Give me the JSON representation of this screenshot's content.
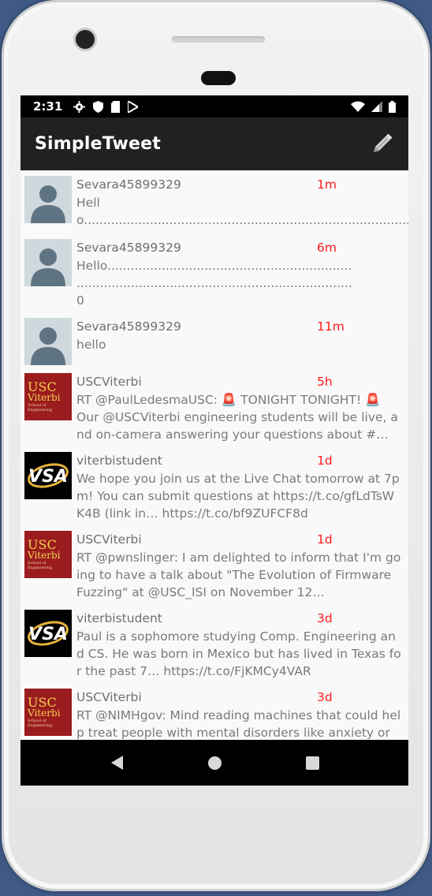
{
  "status_bar": {
    "time": "2:31"
  },
  "app_bar": {
    "title": "SimpleTweet",
    "compose_icon": "pencil-icon"
  },
  "colors": {
    "time_red": "#ff1a1a",
    "appbar": "#212121",
    "usc_red": "#9b1c1f",
    "usc_gold": "#f4d24b"
  },
  "tweets": [
    {
      "user": "Sevara45899329",
      "time": "1m",
      "text": "Hello..................................................................................................................................................",
      "avatar": "default-avatar"
    },
    {
      "user": "Sevara45899329",
      "time": "6m",
      "text": "Hello...............................................................\n.......................................................................\n0",
      "avatar": "default-avatar"
    },
    {
      "user": "Sevara45899329",
      "time": "11m",
      "text": "hello",
      "avatar": "default-avatar"
    },
    {
      "user": "USCViterbi",
      "time": "5h",
      "text": "RT @PaulLedesmaUSC: 🚨 TONIGHT TONIGHT! 🚨\nOur @USCViterbi engineering students will be live, and on-camera answering your questions about #…",
      "avatar": "usc-logo"
    },
    {
      "user": "viterbistudent",
      "time": "1d",
      "text": "We hope you join us at the Live Chat tomorrow at 7pm! You can submit questions at https://t.co/gfLdTsWK4B (link in… https://t.co/bf9ZUFCF8d",
      "avatar": "vsa-logo"
    },
    {
      "user": "USCViterbi",
      "time": "1d",
      "text": "RT @pwnslinger: I am delighted to inform that I'm going to have a talk about \"The Evolution of Firmware Fuzzing\" at @USC_ISI on November 12…",
      "avatar": "usc-logo"
    },
    {
      "user": "viterbistudent",
      "time": "3d",
      "text": "Paul is a sophomore studying Comp. Engineering and CS. He was born in Mexico but has lived in Texas for the past 7… https://t.co/FjKMCy4VAR",
      "avatar": "vsa-logo"
    },
    {
      "user": "USCViterbi",
      "time": "3d",
      "text": "RT @NIMHgov: Mind reading machines that could help treat people with mental disorders like anxiety or",
      "avatar": "usc-logo"
    }
  ],
  "usc_logo": {
    "line1": "USC",
    "line2": "Viterbi",
    "line3": "School of Engineering"
  }
}
